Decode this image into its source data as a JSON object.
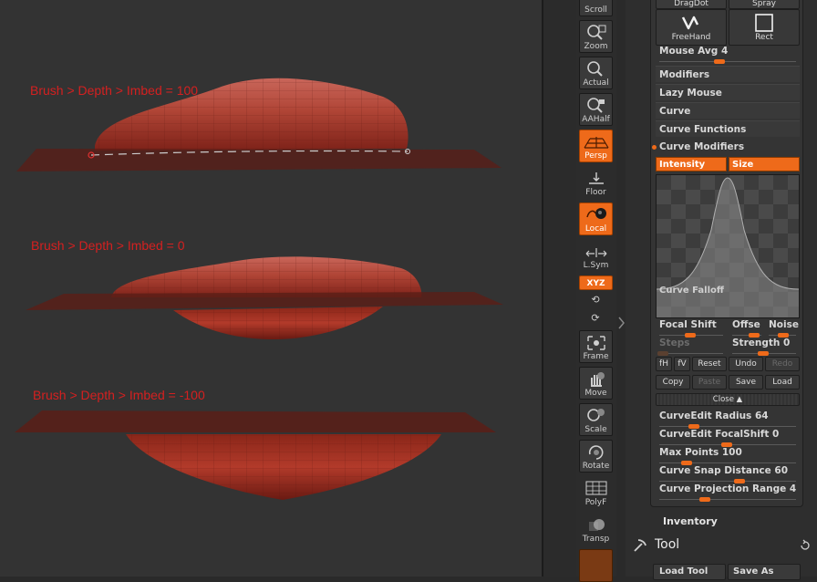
{
  "viewport": {
    "labels": [
      "Brush > Depth > Imbed = 100",
      "Brush > Depth > Imbed = 0",
      "Brush > Depth > Imbed = -100"
    ]
  },
  "shelf": {
    "scroll": "Scroll",
    "zoom": "Zoom",
    "actual": "Actual",
    "aahalf": "AAHalf",
    "persp": "Persp",
    "floor": "Floor",
    "local": "Local",
    "lsym": "L.Sym",
    "xyz": "XYZ",
    "frame": "Frame",
    "move": "Move",
    "scale": "Scale",
    "rotate": "Rotate",
    "polyf": "PolyF",
    "transp": "Transp"
  },
  "stroke": {
    "dragdot": "DragDot",
    "spray": "Spray",
    "freehand": "FreeHand",
    "rect": "Rect",
    "mouse_avg_label": "Mouse Avg",
    "mouse_avg_value": "4",
    "sections": [
      "Modifiers",
      "Lazy Mouse",
      "Curve",
      "Curve Functions"
    ],
    "curve_modifiers": "Curve Modifiers"
  },
  "curve_modifiers": {
    "intensity": "Intensity",
    "size": "Size",
    "graph_label": "Curve Falloff",
    "focal_shift": "Focal Shift",
    "offset": "Offse",
    "noise": "Noise",
    "steps": "Steps",
    "strength_label": "Strength",
    "strength_value": "0",
    "fh": "fH",
    "fv": "fV",
    "reset": "Reset",
    "undo": "Undo",
    "redo": "Redo",
    "copy": "Copy",
    "paste": "Paste",
    "save": "Save",
    "load": "Load",
    "close": "Close"
  },
  "curve_edit": {
    "radius_label": "CurveEdit Radius",
    "radius_value": "64",
    "focal_label": "CurveEdit FocalShift",
    "focal_value": "0",
    "maxpoints_label": "Max Points",
    "maxpoints_value": "100",
    "snap_label": "Curve Snap Distance",
    "snap_value": "60",
    "proj_label": "Curve Projection Range",
    "proj_value": "4"
  },
  "inventory": "Inventory",
  "tool": {
    "title": "Tool",
    "load": "Load Tool",
    "save_as": "Save As"
  },
  "colors": {
    "accent": "#ee6a1a",
    "mesh": "#a8382c",
    "label_red": "#d42020"
  }
}
